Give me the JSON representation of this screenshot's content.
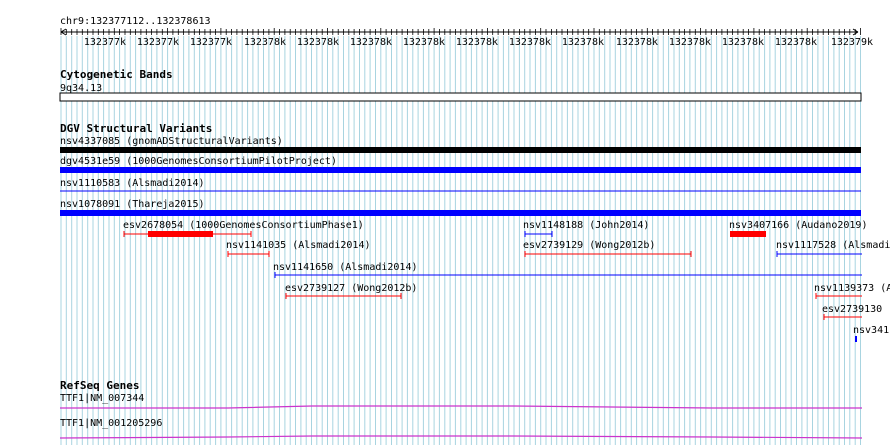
{
  "locus": "chr9:132377112..132378613",
  "ruler": {
    "ticks": [
      "132377k",
      "132377k",
      "132377k",
      "132378k",
      "132378k",
      "132378k",
      "132378k",
      "132378k",
      "132378k",
      "132378k",
      "132378k",
      "132378k",
      "132378k",
      "132378k",
      "132379k"
    ]
  },
  "tracks": {
    "cytobands": {
      "title": "Cytogenetic Bands",
      "band": "9q34.13"
    },
    "dgv": {
      "title": "DGV Structural Variants",
      "features": {
        "nsv4337085": "nsv4337085 (gnomADStructuralVariants)",
        "dgv4531e59": "dgv4531e59 (1000GenomesConsortiumPilotProject)",
        "nsv1110583": "nsv1110583 (Alsmadi2014)",
        "nsv1078091": "nsv1078091 (Thareja2015)",
        "esv2678054": "esv2678054 (1000GenomesConsortiumPhase1)",
        "nsv1148188": "nsv1148188 (John2014)",
        "nsv3407166": "nsv3407166 (Audano2019)",
        "nsv1141035": "nsv1141035 (Alsmadi2014)",
        "esv2739129": "esv2739129 (Wong2012b)",
        "nsv1117528": "nsv1117528 (Alsmadi",
        "nsv1141650": "nsv1141650 (Alsmadi2014)",
        "esv2739127": "esv2739127 (Wong2012b)",
        "nsv1139373": "nsv1139373 (A",
        "esv2739130": "esv2739130",
        "nsv341": "nsv341"
      }
    },
    "refseq": {
      "title": "RefSeq Genes",
      "genes": [
        "TTF1|NM_007344",
        "TTF1|NM_001205296"
      ]
    }
  },
  "colors": {
    "grid": "#a8d4e0",
    "gain_blue": "#0000ff",
    "loss_red": "#ff0000",
    "gene_magenta": "#cc33cc"
  }
}
